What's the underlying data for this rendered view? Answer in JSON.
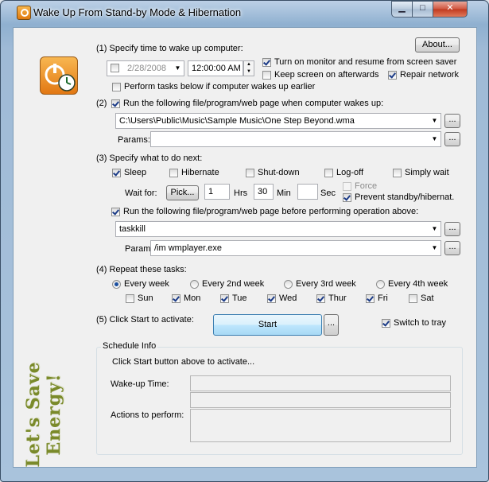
{
  "window": {
    "title": "Wake Up From Stand-by Mode & Hibernation",
    "min": "▁",
    "max": "□",
    "close": "✕"
  },
  "about_label": "About...",
  "step1": {
    "label": "(1) Specify time to wake up computer:",
    "date": "2/28/2008",
    "time": "12:00:00 AM",
    "turn_on_monitor": "Turn on monitor and resume from screen saver",
    "keep_screen": "Keep screen on afterwards",
    "repair_network": "Repair network",
    "perform_early": "Perform tasks below if computer wakes up earlier"
  },
  "step2": {
    "label": "Run the following file/program/web page when computer wakes up:",
    "prefix": "(2)",
    "file": "C:\\Users\\Public\\Music\\Sample Music\\One Step Beyond.wma",
    "params_label": "Params:",
    "params": "",
    "browse": "..."
  },
  "step3": {
    "label": "(3) Specify what to do next:",
    "options": [
      "Sleep",
      "Hibernate",
      "Shut-down",
      "Log-off",
      "Simply wait"
    ],
    "wait_for": "Wait for:",
    "pick": "Pick...",
    "hrs_value": "1",
    "hrs": "Hrs",
    "min_value": "30",
    "min": "Min",
    "sec_value": "",
    "sec": "Sec",
    "force": "Force",
    "prevent": "Prevent standby/hibernat.",
    "run_before": "Run the following file/program/web page before performing operation above:",
    "file": "taskkill",
    "params_label": "Params:",
    "params": "/im wmplayer.exe",
    "browse": "..."
  },
  "step4": {
    "label": "(4) Repeat these tasks:",
    "repeat": [
      "Every week",
      "Every 2nd week",
      "Every 3rd week",
      "Every 4th week"
    ],
    "days": [
      "Sun",
      "Mon",
      "Tue",
      "Wed",
      "Thur",
      "Fri",
      "Sat"
    ]
  },
  "step5": {
    "label": "(5) Click Start to activate:",
    "start": "Start",
    "more": "...",
    "switch_tray": "Switch to tray"
  },
  "schedule": {
    "title": "Schedule Info",
    "hint": "Click Start button above to activate...",
    "wakeup_label": "Wake-up Time:",
    "actions_label": "Actions to perform:"
  },
  "slogan": "Let's Save Energy!",
  "colors": {
    "accent": "#3c7fb1",
    "slogan": "#7a8a2a"
  }
}
